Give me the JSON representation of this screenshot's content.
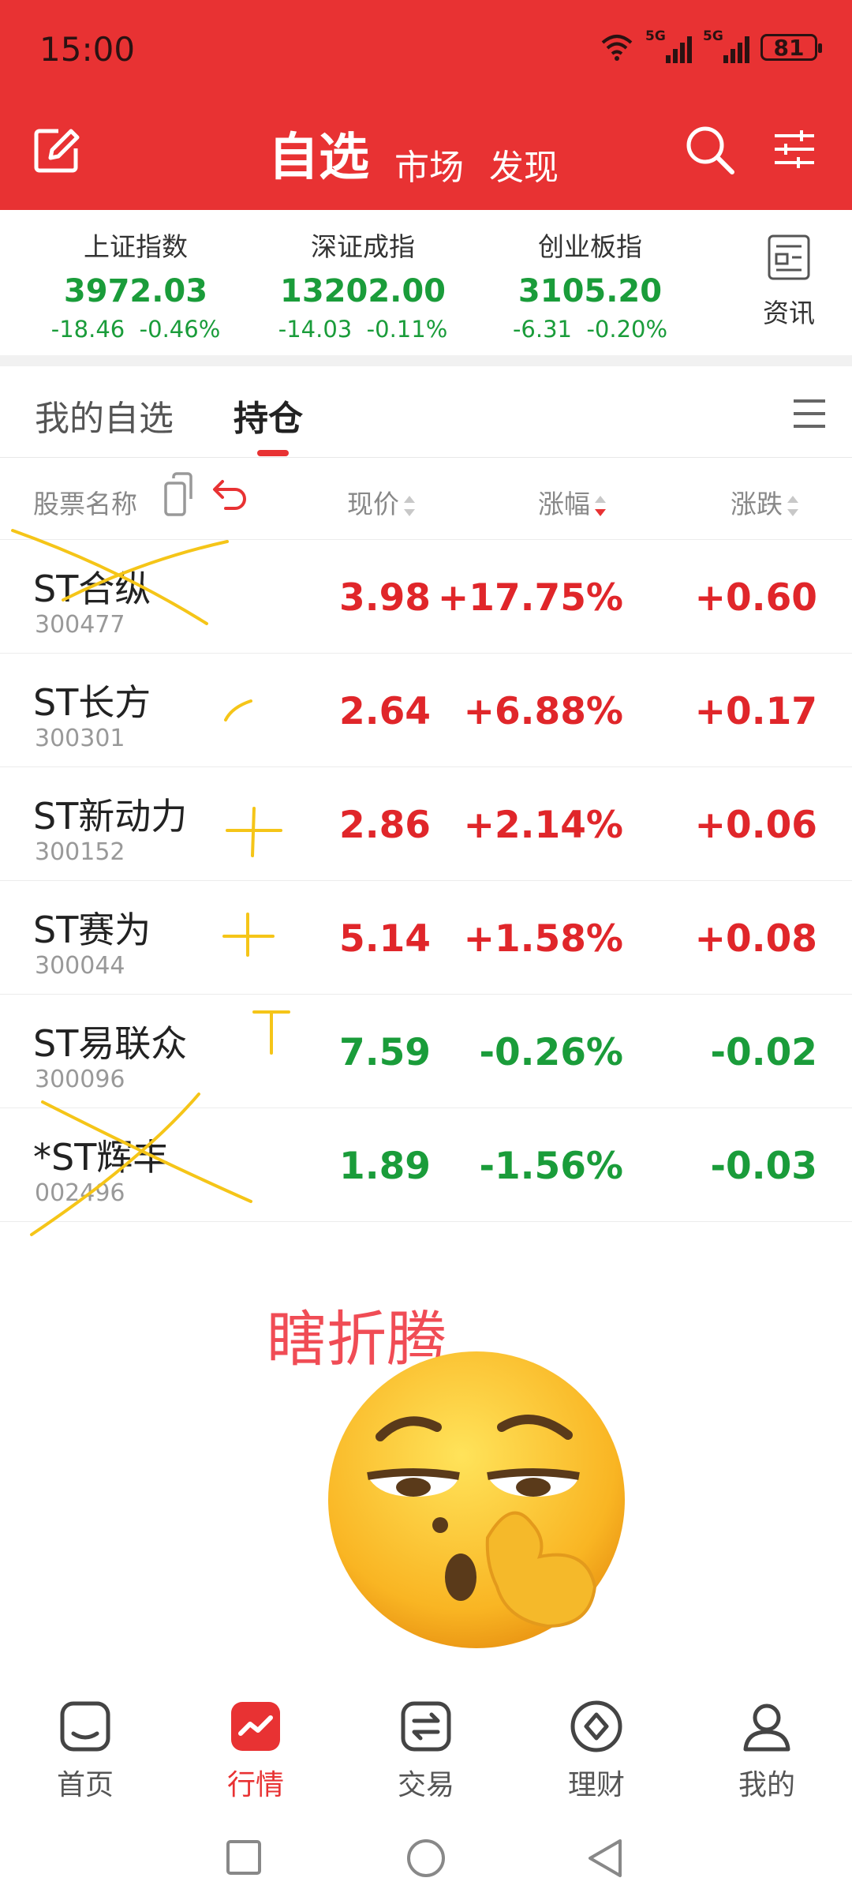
{
  "status_bar": {
    "time": "15:00",
    "signal1": "5G",
    "signal2": "5G",
    "battery": "81"
  },
  "header": {
    "tabs": [
      {
        "label": "自选",
        "active": true
      },
      {
        "label": "市场",
        "active": false
      },
      {
        "label": "发现",
        "active": false
      }
    ]
  },
  "indices": [
    {
      "name": "上证指数",
      "value": "3972.03",
      "change": "-18.46",
      "pct": "-0.46%"
    },
    {
      "name": "深证成指",
      "value": "13202.00",
      "change": "-14.03",
      "pct": "-0.11%"
    },
    {
      "name": "创业板指",
      "value": "3105.20",
      "change": "-6.31",
      "pct": "-0.20%"
    }
  ],
  "news_label": "资讯",
  "subtabs": [
    {
      "label": "我的自选",
      "active": false
    },
    {
      "label": "持仓",
      "active": true
    }
  ],
  "table": {
    "headers": {
      "name": "股票名称",
      "price": "现价",
      "pct": "涨幅",
      "change": "涨跌"
    },
    "rows": [
      {
        "name": "ST合纵",
        "code": "300477",
        "price": "3.98",
        "pct": "+17.75%",
        "change": "+0.60",
        "direction": "up"
      },
      {
        "name": "ST长方",
        "code": "300301",
        "price": "2.64",
        "pct": "+6.88%",
        "change": "+0.17",
        "direction": "up"
      },
      {
        "name": "ST新动力",
        "code": "300152",
        "price": "2.86",
        "pct": "+2.14%",
        "change": "+0.06",
        "direction": "up"
      },
      {
        "name": "ST赛为",
        "code": "300044",
        "price": "5.14",
        "pct": "+1.58%",
        "change": "+0.08",
        "direction": "up"
      },
      {
        "name": "ST易联众",
        "code": "300096",
        "price": "7.59",
        "pct": "-0.26%",
        "change": "-0.02",
        "direction": "down"
      },
      {
        "name": "*ST辉丰",
        "code": "002496",
        "price": "1.89",
        "pct": "-1.56%",
        "change": "-0.03",
        "direction": "down"
      }
    ]
  },
  "annotation": {
    "caption": "瞎折腾"
  },
  "bottom_nav": [
    {
      "label": "首页",
      "icon": "home-icon",
      "active": false
    },
    {
      "label": "行情",
      "icon": "market-icon",
      "active": true
    },
    {
      "label": "交易",
      "icon": "trade-icon",
      "active": false
    },
    {
      "label": "理财",
      "icon": "wealth-icon",
      "active": false
    },
    {
      "label": "我的",
      "icon": "profile-icon",
      "active": false
    }
  ],
  "colors": {
    "brand_red": "#e83233",
    "rise": "#e0262a",
    "fall": "#1a9c3a",
    "annotation": "#f5c518"
  }
}
